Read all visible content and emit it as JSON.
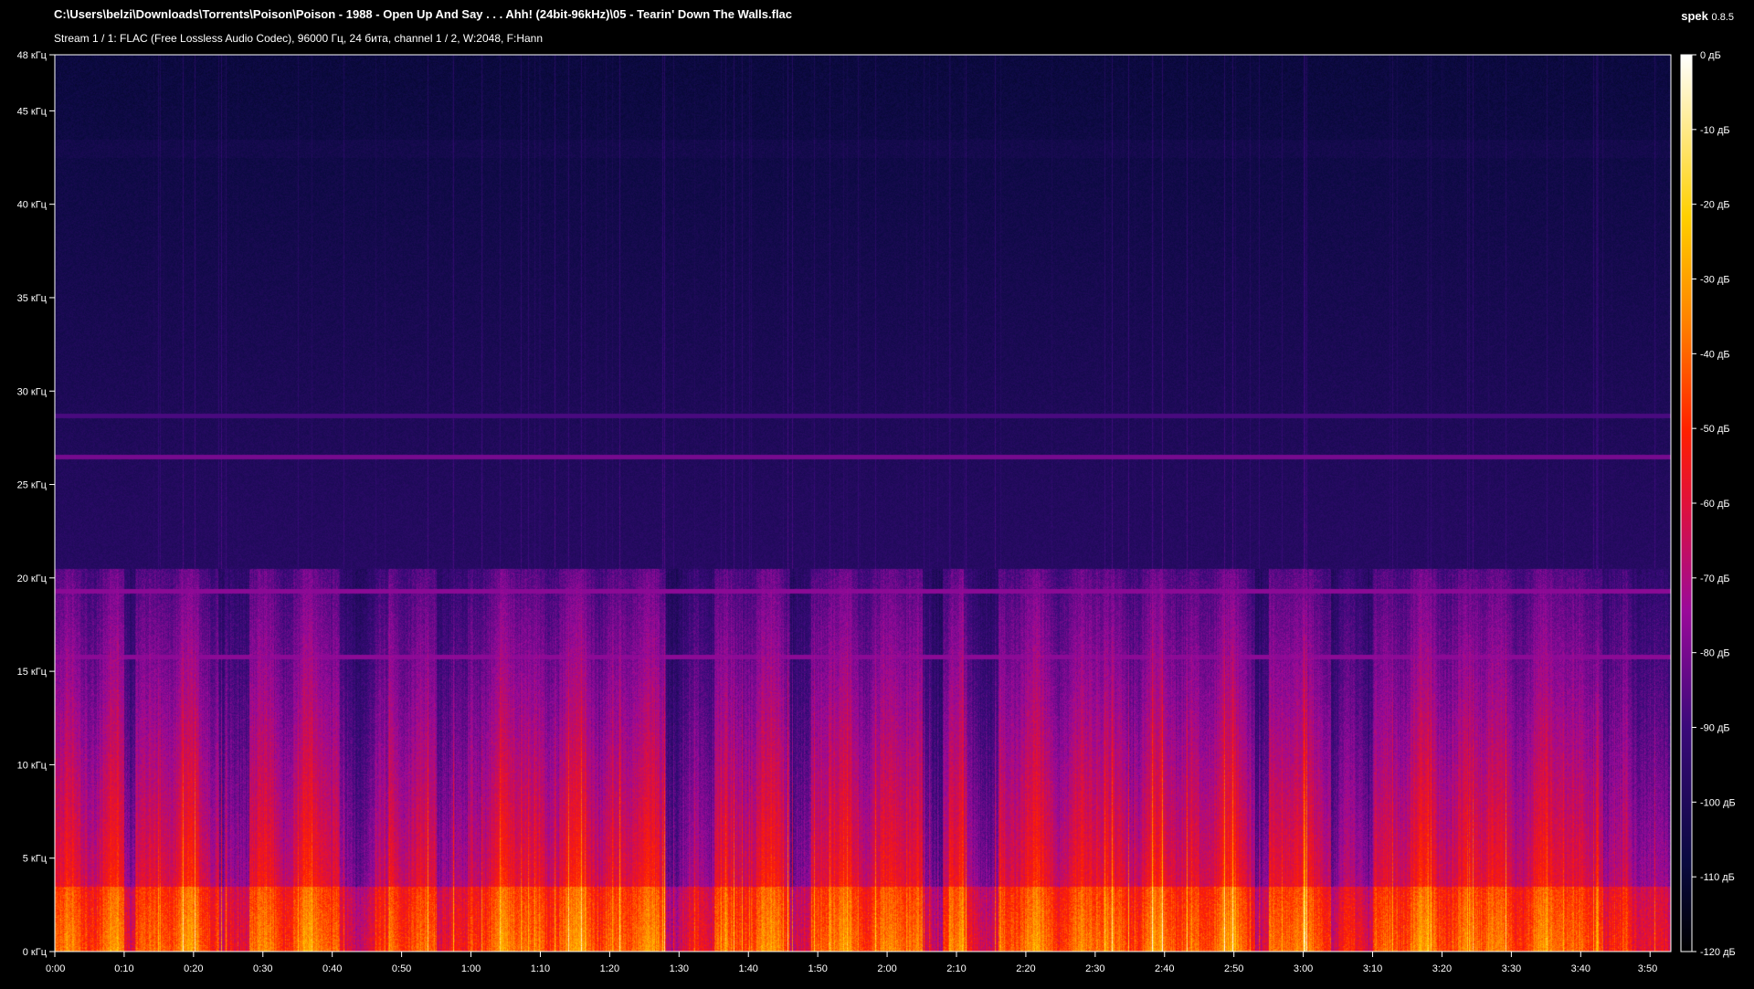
{
  "header": {
    "file_path": "C:\\Users\\belzi\\Downloads\\Torrents\\Poison\\Poison - 1988 - Open Up And Say . . . Ahh! (24bit-96kHz)\\05 - Tearin' Down The Walls.flac",
    "stream_info": "Stream 1 / 1: FLAC (Free Lossless Audio Codec), 96000 Гц, 24 бита, channel 1 / 2, W:2048, F:Hann",
    "app_name": "spek",
    "app_version": "0.8.5"
  },
  "chart_data": {
    "type": "heatmap",
    "title": "C:\\Users\\belzi\\Downloads\\Torrents\\Poison\\Poison - 1988 - Open Up And Say . . . Ahh! (24bit-96kHz)\\05 - Tearin' Down The Walls.flac",
    "subtitle": "Stream 1 / 1: FLAC (Free Lossless Audio Codec), 96000 Гц, 24 бита, channel 1 / 2, W:2048, F:Hann",
    "x_axis": {
      "label": "",
      "unit": "time",
      "range_seconds": [
        0,
        233
      ],
      "ticks": [
        "0:00",
        "0:10",
        "0:20",
        "0:30",
        "0:40",
        "0:50",
        "1:00",
        "1:10",
        "1:20",
        "1:30",
        "1:40",
        "1:50",
        "2:00",
        "2:10",
        "2:20",
        "2:30",
        "2:40",
        "2:50",
        "3:00",
        "3:10",
        "3:20",
        "3:30",
        "3:40",
        "3:50"
      ]
    },
    "y_axis": {
      "label": "",
      "unit": "kHz",
      "range": [
        0,
        48
      ],
      "ticks": [
        "0 кГц",
        "5 кГц",
        "10 кГц",
        "15 кГц",
        "20 кГц",
        "25 кГц",
        "30 кГц",
        "35 кГц",
        "40 кГц",
        "45 кГц",
        "48 кГц"
      ]
    },
    "color_scale": {
      "unit": "dB",
      "range": [
        -120,
        0
      ],
      "ticks": [
        "0 дБ",
        "-10 дБ",
        "-20 дБ",
        "-30 дБ",
        "-40 дБ",
        "-50 дБ",
        "-60 дБ",
        "-70 дБ",
        "-80 дБ",
        "-90 дБ",
        "-100 дБ",
        "-110 дБ",
        "-120 дБ"
      ],
      "colors": [
        "#000000",
        "#0a0a40",
        "#3a0a7a",
        "#9a0a9a",
        "#e0103a",
        "#ff2000",
        "#ff8000",
        "#ffd000",
        "#ffffff"
      ]
    },
    "features": {
      "lowpass_cutoff_khz": 20.5,
      "energy_band_khz": [
        0,
        20.5
      ],
      "dark_gaps_seconds": [
        [
          10,
          11.5
        ],
        [
          23.5,
          28
        ],
        [
          41,
          48
        ],
        [
          55,
          59.5
        ],
        [
          88,
          95
        ],
        [
          106,
          109
        ],
        [
          125,
          128
        ],
        [
          131,
          136
        ],
        [
          173,
          175
        ],
        [
          184,
          190
        ],
        [
          223,
          226
        ]
      ],
      "tone_lines_khz": [
        26.5,
        28.7,
        15.8,
        19.3
      ],
      "faint_band_khz": [
        42.5,
        43.5
      ]
    }
  }
}
